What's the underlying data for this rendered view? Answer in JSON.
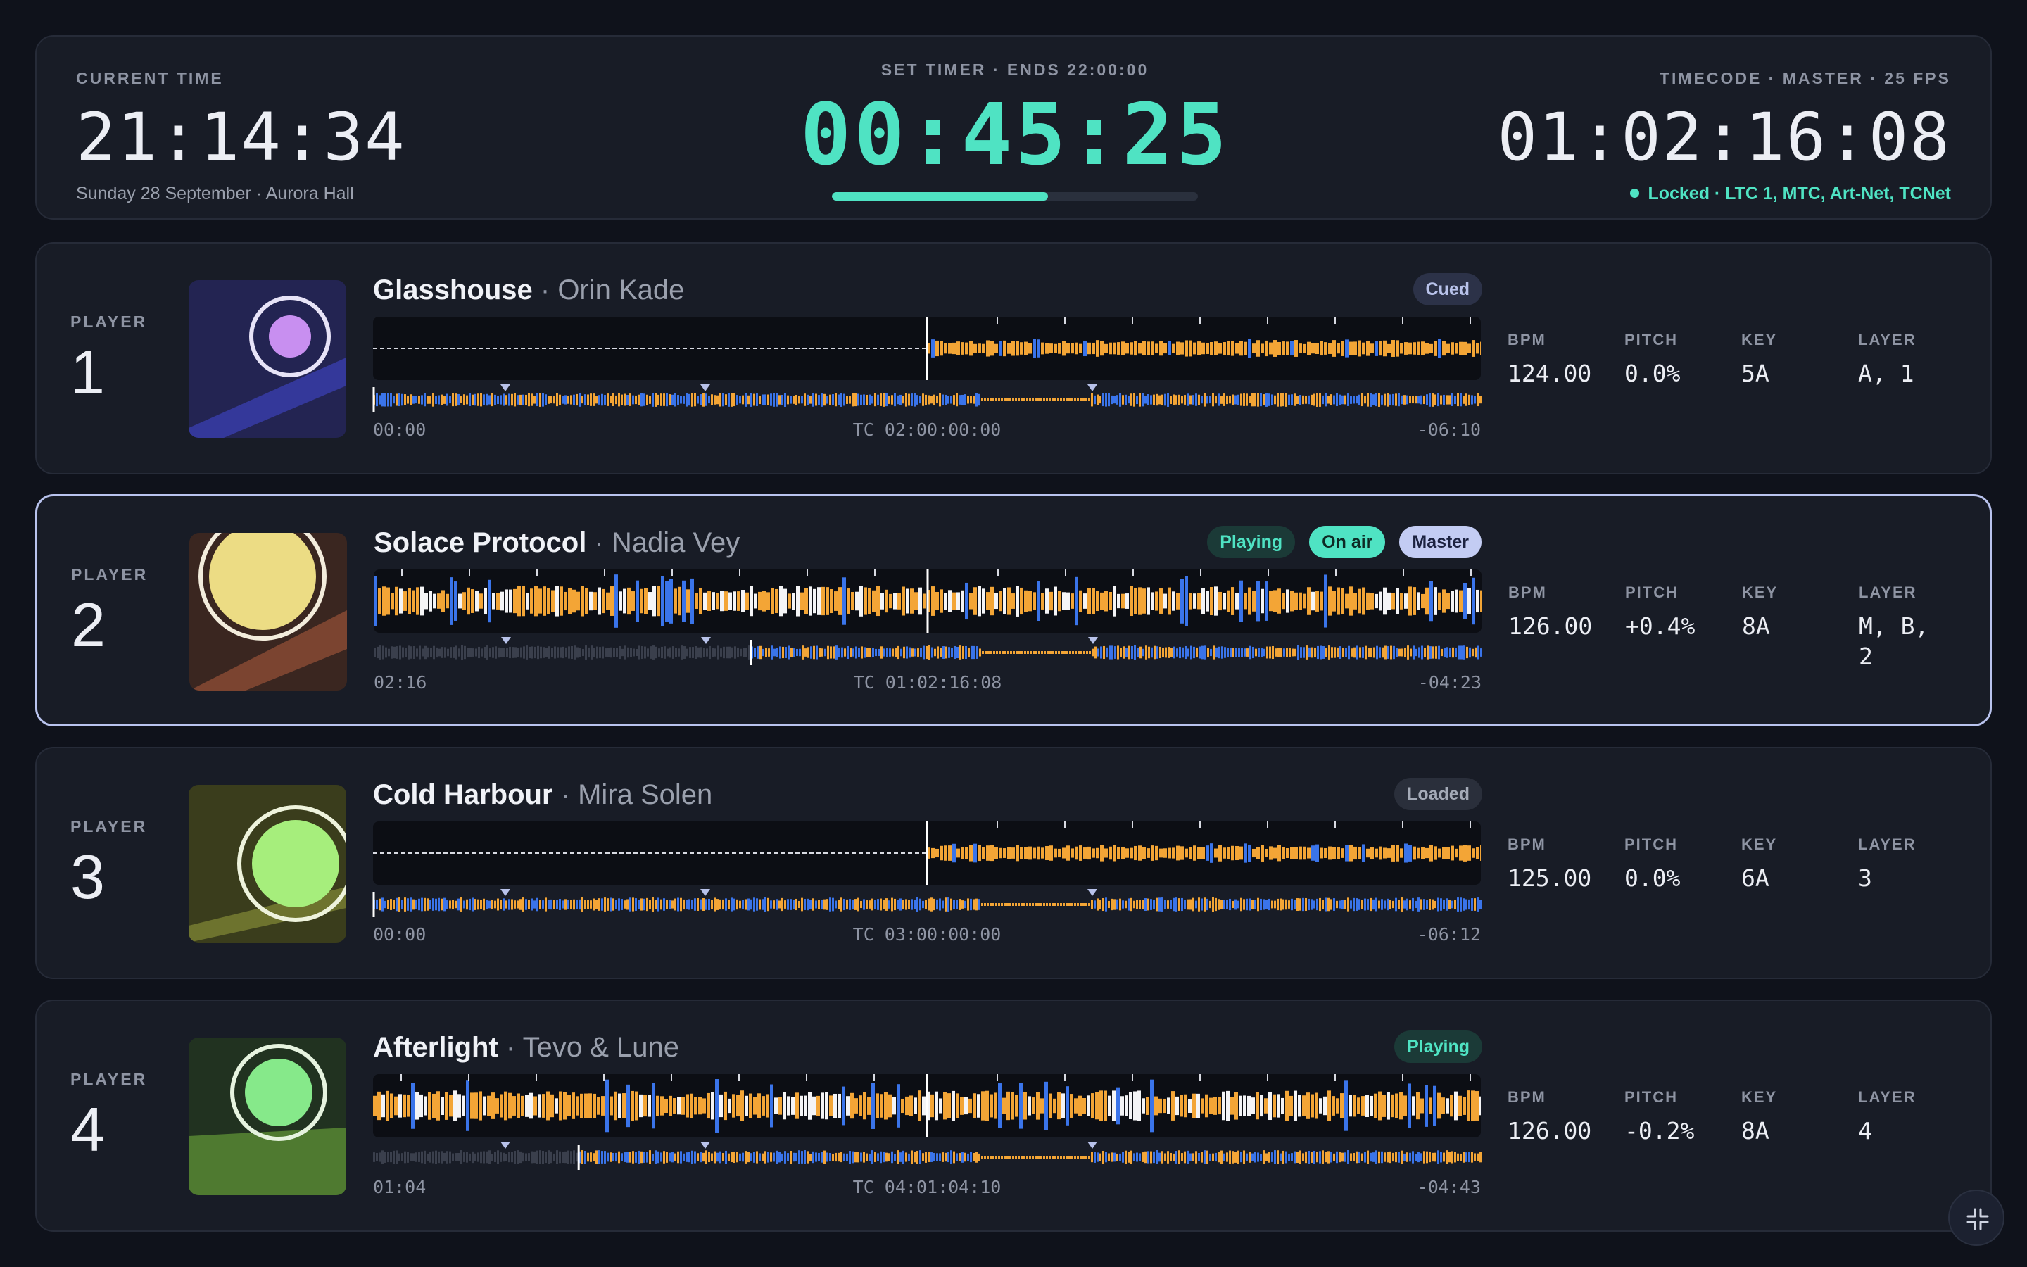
{
  "header": {
    "current_time_label": "CURRENT TIME",
    "current_time": "21:14:34",
    "date_venue": "Sunday 28 September · Aurora Hall",
    "set_timer_label": "SET TIMER · ENDS 22:00:00",
    "set_timer": "00:45:25",
    "set_timer_progress": 0.59,
    "timecode_label": "TIMECODE · MASTER · 25 FPS",
    "timecode": "01:02:16:08",
    "lock_status": "Locked · LTC 1, MTC, Art-Net, TCNet"
  },
  "colors": {
    "accent": "#4fe3c3",
    "waveform_orange": "#f3a536",
    "waveform_blue": "#3a74ea",
    "waveform_white": "#f4f4f6",
    "active_border": "#b9c3ee"
  },
  "players": [
    {
      "label": "PLAYER",
      "number": "1",
      "title": "Glasshouse",
      "artist": "Orin Kade",
      "badges": [
        {
          "text": "Cued",
          "kind": "cued"
        }
      ],
      "elapsed": "00:00",
      "timecode": "TC 02:00:00:00",
      "remaining": "-06:10",
      "progress": 0.0,
      "playing": false,
      "bpm_label": "BPM",
      "bpm": "124.00",
      "pitch_label": "PITCH",
      "pitch": "0.0%",
      "key_label": "KEY",
      "key": "5A",
      "layer_label": "LAYER",
      "layer": "A, 1",
      "art": {
        "bg": "#232452",
        "band": "#34389a",
        "circle": "#c88ff0",
        "ring": "#e7e3f7"
      }
    },
    {
      "label": "PLAYER",
      "number": "2",
      "title": "Solace Protocol",
      "artist": "Nadia Vey",
      "badges": [
        {
          "text": "Playing",
          "kind": "playing"
        },
        {
          "text": "On air",
          "kind": "onair"
        },
        {
          "text": "Master",
          "kind": "master"
        }
      ],
      "elapsed": "02:16",
      "timecode": "TC 01:02:16:08",
      "remaining": "-04:23",
      "progress": 0.34,
      "playing": true,
      "bpm_label": "BPM",
      "bpm": "126.00",
      "pitch_label": "PITCH",
      "pitch": "+0.4%",
      "key_label": "KEY",
      "key": "8A",
      "layer_label": "LAYER",
      "layer": "M, B, 2",
      "art": {
        "bg": "#3a2620",
        "band": "#7b4430",
        "circle": "#ecdc84",
        "ring": "#f3ecdc"
      }
    },
    {
      "label": "PLAYER",
      "number": "3",
      "title": "Cold Harbour",
      "artist": "Mira Solen",
      "badges": [
        {
          "text": "Loaded",
          "kind": "loaded"
        }
      ],
      "elapsed": "00:00",
      "timecode": "TC 03:00:00:00",
      "remaining": "-06:12",
      "progress": 0.0,
      "playing": false,
      "bpm_label": "BPM",
      "bpm": "125.00",
      "pitch_label": "PITCH",
      "pitch": "0.0%",
      "key_label": "KEY",
      "key": "6A",
      "layer_label": "LAYER",
      "layer": "3",
      "art": {
        "bg": "#3a3d1c",
        "band": "#6d732e",
        "circle": "#a6ee7c",
        "ring": "#eef3dc"
      }
    },
    {
      "label": "PLAYER",
      "number": "4",
      "title": "Afterlight",
      "artist": "Tevo & Lune",
      "badges": [
        {
          "text": "Playing",
          "kind": "playing"
        }
      ],
      "elapsed": "01:04",
      "timecode": "TC 04:01:04:10",
      "remaining": "-04:43",
      "progress": 0.185,
      "playing": true,
      "bpm_label": "BPM",
      "bpm": "126.00",
      "pitch_label": "PITCH",
      "pitch": "-0.2%",
      "key_label": "KEY",
      "key": "8A",
      "layer_label": "LAYER",
      "layer": "4",
      "art": {
        "bg": "#213220",
        "band": "#4f7a30",
        "circle": "#86e98a",
        "ring": "#e6f3df"
      }
    }
  ],
  "controls": {
    "fullscreen_icon": "collapse-icon"
  }
}
